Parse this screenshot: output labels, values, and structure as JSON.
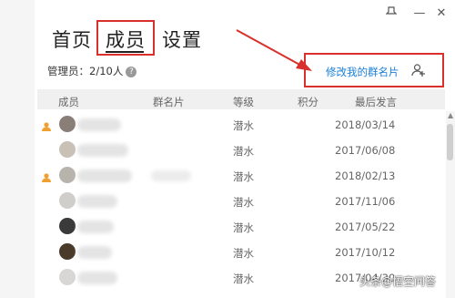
{
  "window": {
    "controls": [
      "pin-icon",
      "minimize-icon",
      "close-icon"
    ]
  },
  "tabs": [
    {
      "label": "首页",
      "active": false
    },
    {
      "label": "成员",
      "active": true
    },
    {
      "label": "设置",
      "active": false
    }
  ],
  "admin_count_label": "管理员：2/10人",
  "edit_card_label": "修改我的群名片",
  "table": {
    "columns": [
      "成员",
      "群名片",
      "等级",
      "积分",
      "最后发言"
    ],
    "rows": [
      {
        "admin": true,
        "level": "潜水",
        "last": "2018/03/14"
      },
      {
        "admin": false,
        "level": "潜水",
        "last": "2017/06/08"
      },
      {
        "admin": true,
        "level": "潜水",
        "last": "2018/02/13"
      },
      {
        "admin": false,
        "level": "潜水",
        "last": "2017/11/06"
      },
      {
        "admin": false,
        "level": "潜水",
        "last": "2017/05/22"
      },
      {
        "admin": false,
        "level": "潜水",
        "last": "2017/10/12"
      },
      {
        "admin": false,
        "level": "潜水",
        "last": "2017/04/30"
      }
    ]
  },
  "colors": {
    "highlight": "#d9302c",
    "link": "#1a7fd8",
    "admin_icon": "#f0a030"
  },
  "watermark": "头条@悟空问答"
}
